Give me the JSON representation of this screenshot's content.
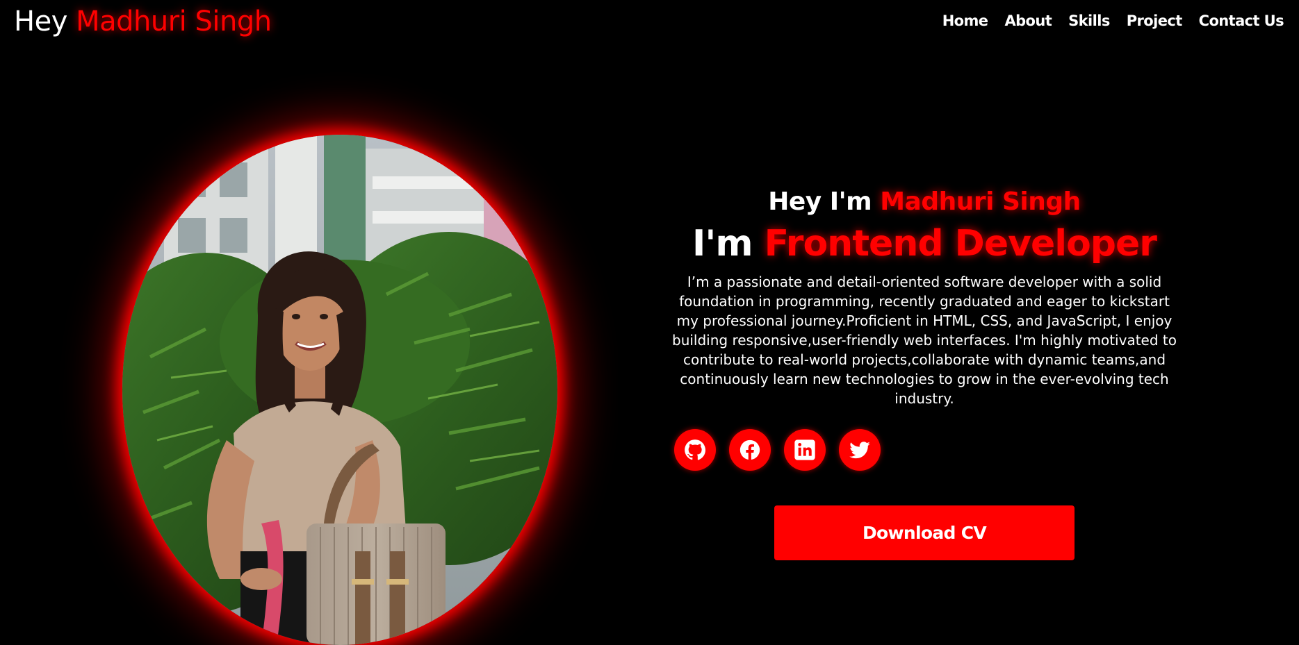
{
  "header": {
    "logo_prefix": "Hey",
    "logo_name": "Madhuri Singh",
    "nav": [
      "Home",
      "About",
      "Skills",
      "Project",
      "Contact Us"
    ]
  },
  "hero": {
    "greeting_prefix": "Hey I'm",
    "greeting_name": "Madhuri Singh",
    "role_prefix": "I'm",
    "role_title": "Frontend Developer",
    "bio": "I’m a passionate and detail-oriented software developer with a solid foundation in programming, recently graduated and eager to kickstart my professional journey.Proficient in HTML, CSS, and JavaScript, I enjoy building responsive,user-friendly web interfaces. I'm highly motivated to contribute to real-world projects,collaborate with dynamic teams,and continuously learn new technologies to grow in the ever-evolving tech industry.",
    "socials": [
      "github-icon",
      "facebook-icon",
      "linkedin-icon",
      "twitter-icon"
    ],
    "cv_button": "Download CV"
  },
  "colors": {
    "accent": "#ff0000",
    "background": "#000000",
    "text": "#ffffff"
  }
}
